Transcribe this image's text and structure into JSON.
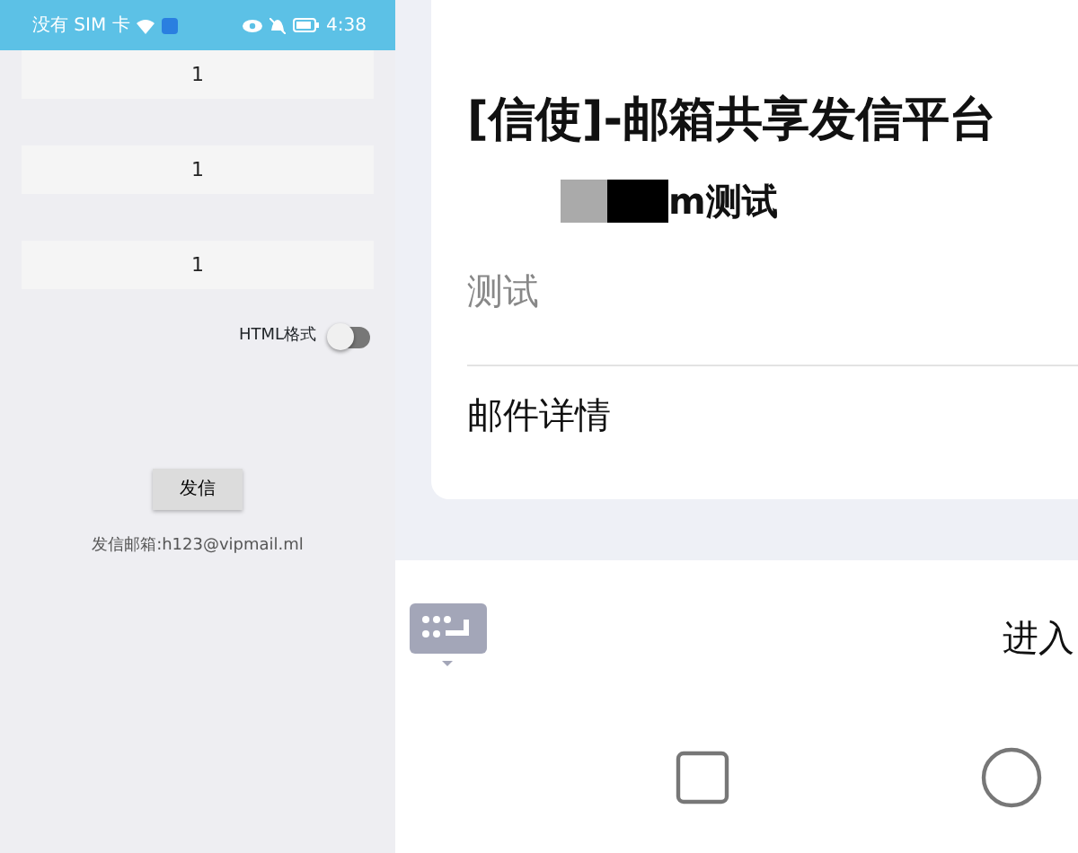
{
  "left_screen": {
    "status_bar": {
      "carrier": "没有 SIM 卡",
      "time": "4:38"
    },
    "fields": [
      {
        "value": "1"
      },
      {
        "value": "1"
      },
      {
        "value": "1"
      }
    ],
    "toggle": {
      "label": "HTML格式",
      "on": false
    },
    "send_button": "发信",
    "sender": "发信邮箱:h123@vipmail.ml"
  },
  "right_screen": {
    "card": {
      "title": "[信使]-邮箱共享发信平台",
      "subject": "m测试",
      "body": "测试",
      "details_link": "邮件详情"
    },
    "enter_button": "进入"
  }
}
